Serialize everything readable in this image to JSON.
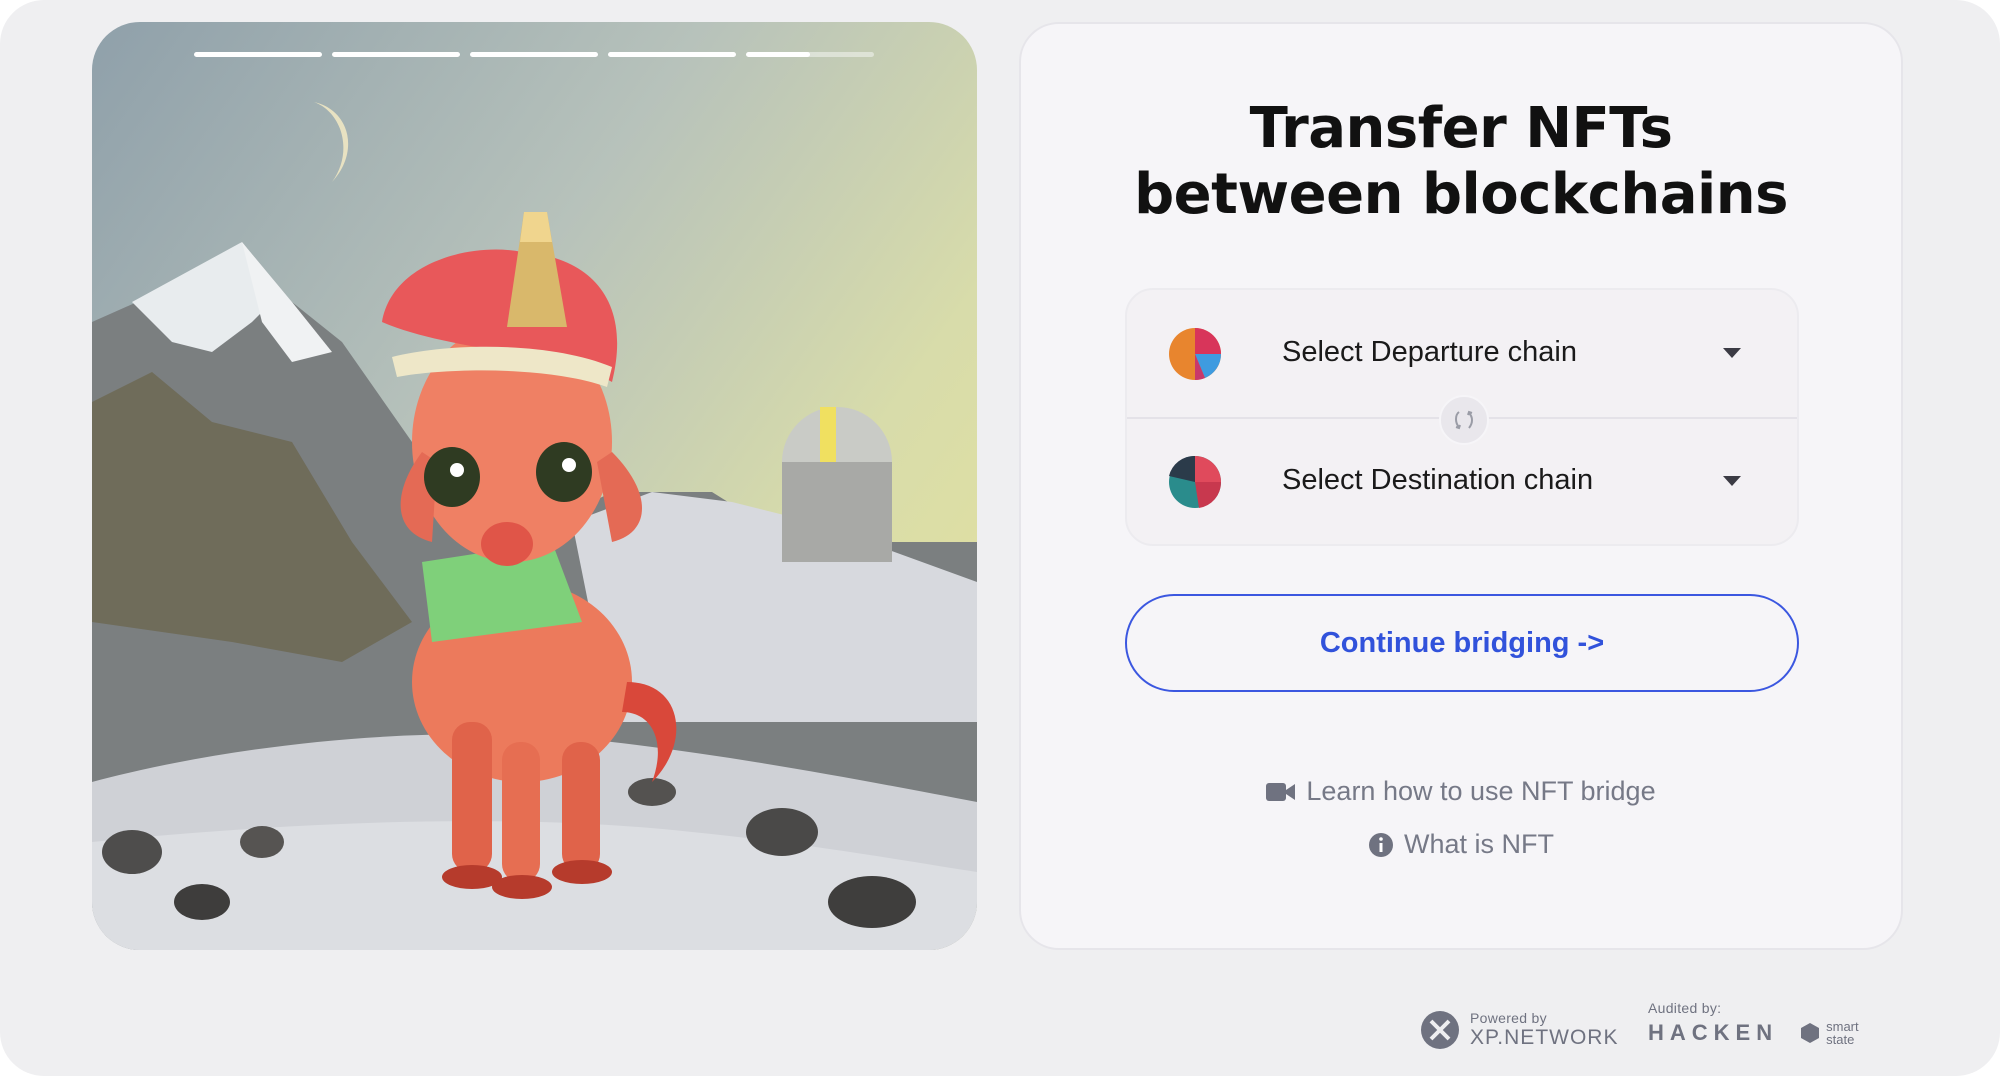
{
  "hero": {
    "slideshow_segments": 5,
    "active_segment": 5,
    "active_segment_progress": 0.5
  },
  "panel": {
    "title_line1": "Transfer NFTs",
    "title_line2": "between blockchains",
    "departure": {
      "label": "Select Departure chain",
      "icon": "chain-placeholder-icon"
    },
    "destination": {
      "label": "Select Destination chain",
      "icon": "chain-placeholder-icon"
    },
    "swap_icon": "swap-arrows-icon",
    "continue_label": "Continue bridging ->",
    "learn_link": "Learn how to use NFT bridge",
    "what_link": "What is NFT"
  },
  "footer": {
    "powered_by": "Powered by",
    "xp_brand": "XP.NETWORK",
    "audited_by": "Audited by:",
    "auditor1": "HACKEN",
    "auditor2_line1": "smart",
    "auditor2_line2": "state"
  },
  "colors": {
    "accent": "#3152db",
    "text_muted": "#767987",
    "panel_bg": "#f6f5f8"
  }
}
